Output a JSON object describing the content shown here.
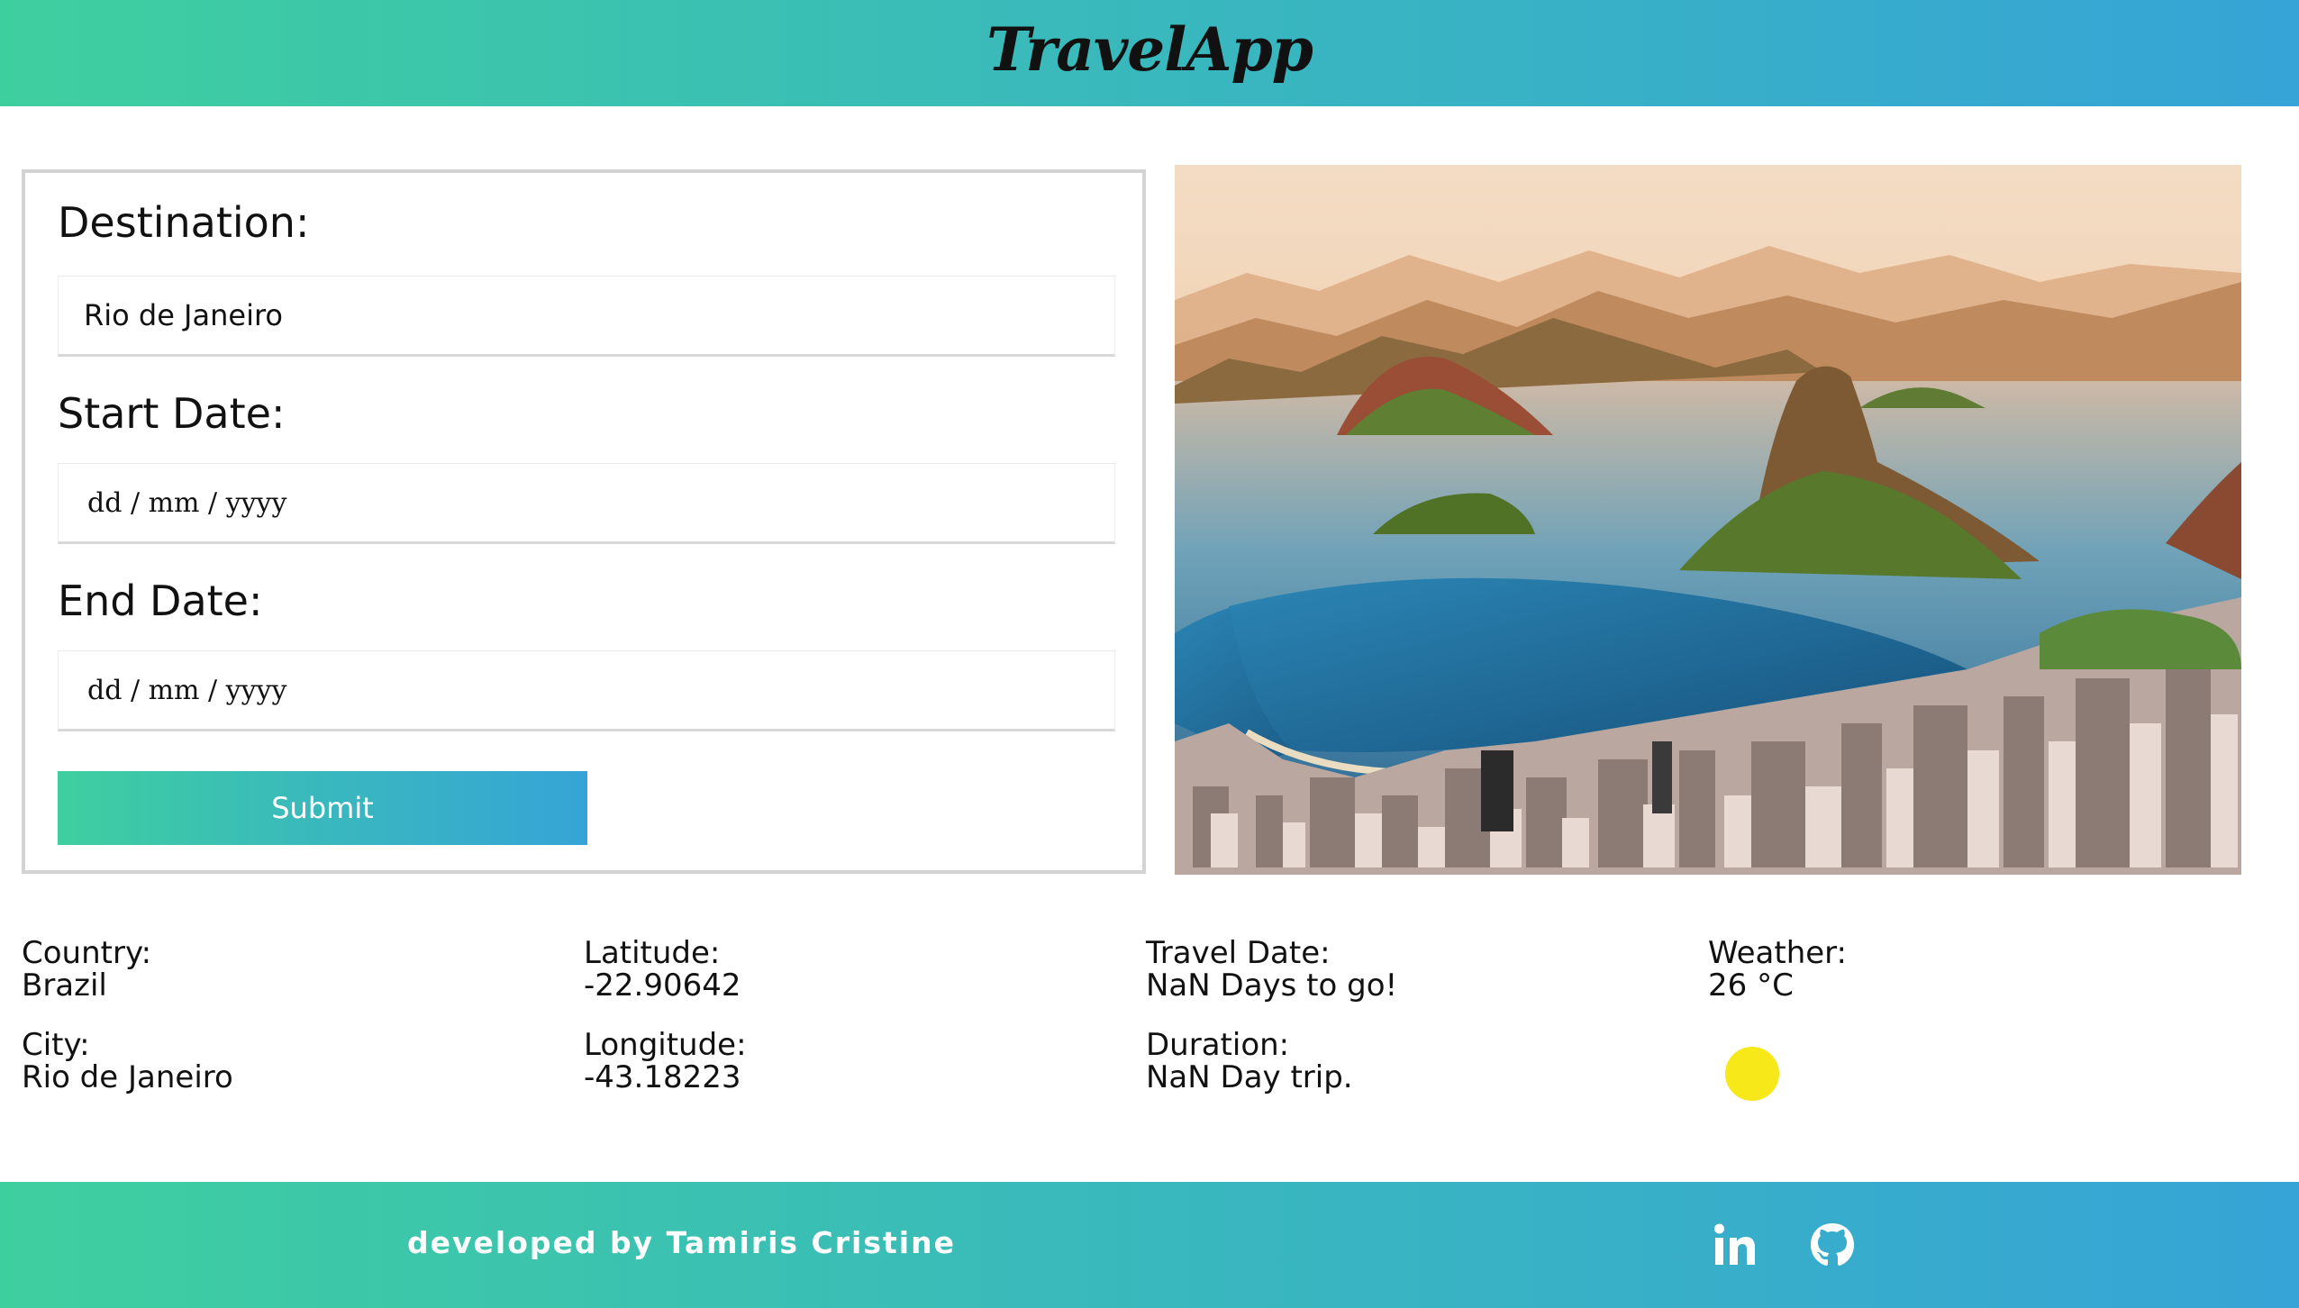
{
  "header": {
    "title": "TravelApp"
  },
  "form": {
    "destination_label": "Destination:",
    "destination_value": "Rio de Janeiro",
    "start_label": "Start Date:",
    "start_placeholder": "dd / mm / yyyy",
    "end_label": "End Date:",
    "end_placeholder": "dd / mm / yyyy",
    "submit_label": "Submit"
  },
  "results": {
    "country_label": "Country:",
    "country_value": "Brazil",
    "city_label": "City:",
    "city_value": "Rio de Janeiro",
    "latitude_label": "Latitude:",
    "latitude_value": "-22.90642",
    "longitude_label": "Longitude:",
    "longitude_value": "-43.18223",
    "travel_date_label": "Travel Date:",
    "travel_date_value": "NaN Days to go!",
    "duration_label": "Duration:",
    "duration_value": "NaN Day trip.",
    "weather_label": "Weather:",
    "weather_value": "26 °C",
    "weather_icon": "sun-icon"
  },
  "footer": {
    "credit": "developed by Tamiris Cristine",
    "icons": [
      "linkedin-icon",
      "github-icon"
    ]
  },
  "colors": {
    "gradient_start": "#3ecf9f",
    "gradient_end": "#36a4d6",
    "sun": "#f7e81a"
  }
}
